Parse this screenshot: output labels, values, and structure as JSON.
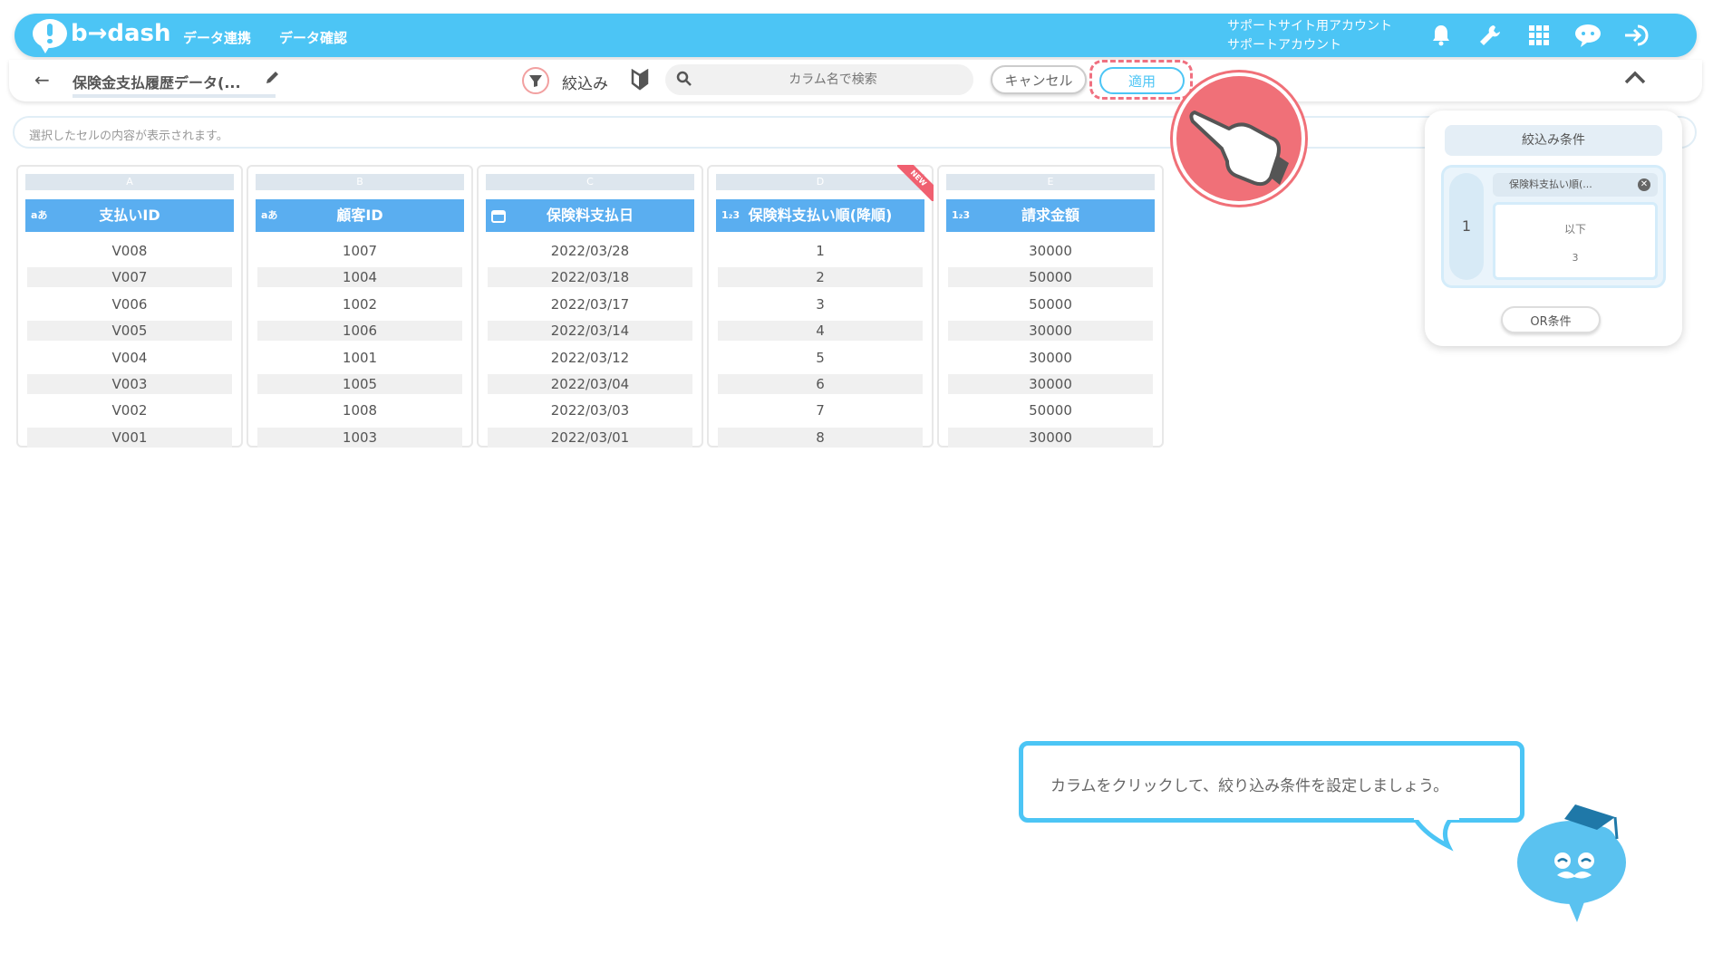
{
  "header": {
    "logo_text": "b→dash",
    "nav": [
      "データ連携",
      "データ確認"
    ],
    "account_line1": "サポートサイト用アカウント",
    "account_line2": "サポートアカウント",
    "brand_color": "#4cc5f5",
    "icons": [
      "bell-icon",
      "wrench-icon",
      "grid-icon",
      "chat-icon",
      "logout-icon"
    ]
  },
  "toolbar": {
    "dataset_title": "保険金支払履歴データ(...",
    "filter_label": "絞込み",
    "search_placeholder": "カラム名で検索",
    "cancel_label": "キャンセル",
    "apply_label": "適用"
  },
  "cellbar": {
    "placeholder": "選択したセルの内容が表示されます。"
  },
  "table": {
    "columns": [
      {
        "letter": "A",
        "type": "aあ",
        "name": "支払いID",
        "values": [
          "V008",
          "V007",
          "V006",
          "V005",
          "V004",
          "V003",
          "V002",
          "V001"
        ]
      },
      {
        "letter": "B",
        "type": "aあ",
        "name": "顧客ID",
        "values": [
          "1007",
          "1004",
          "1002",
          "1006",
          "1001",
          "1005",
          "1008",
          "1003"
        ]
      },
      {
        "letter": "C",
        "type": "calendar",
        "name": "保険料支払日",
        "values": [
          "2022/03/28",
          "2022/03/18",
          "2022/03/17",
          "2022/03/14",
          "2022/03/12",
          "2022/03/04",
          "2022/03/03",
          "2022/03/01"
        ]
      },
      {
        "letter": "D",
        "type": "1₂3",
        "name": "保険料支払い順(降順)",
        "badge": "NEW",
        "values": [
          "1",
          "2",
          "3",
          "4",
          "5",
          "6",
          "7",
          "8"
        ]
      },
      {
        "letter": "E",
        "type": "1₂3",
        "name": "請求金額",
        "values": [
          "30000",
          "50000",
          "50000",
          "30000",
          "30000",
          "30000",
          "50000",
          "30000"
        ]
      }
    ]
  },
  "filter_panel": {
    "title": "絞込み条件",
    "group_number": "1",
    "condition_column": "保険料支払い順(...",
    "operator": "以下",
    "value": "3",
    "or_label": "OR条件"
  },
  "tooltip": {
    "message": "カラムをクリックして、絞り込み条件を設定しましょう。"
  }
}
